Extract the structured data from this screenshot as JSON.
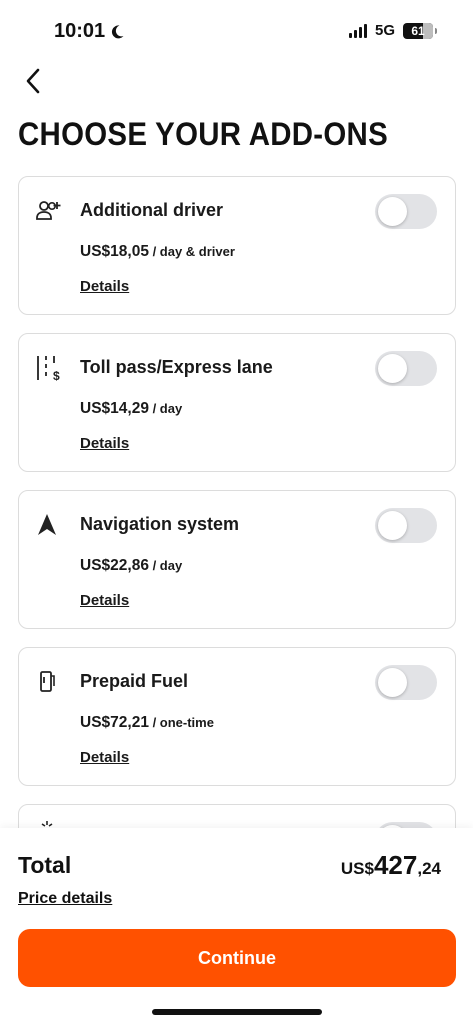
{
  "status": {
    "time": "10:01",
    "network": "5G",
    "battery": "61"
  },
  "header": {
    "title": "CHOOSE YOUR ADD-ONS"
  },
  "addons": [
    {
      "name": "Additional driver",
      "price": "US$18,05",
      "unit": " / day & driver",
      "details": "Details",
      "icon": "add-person-icon",
      "enabled": false
    },
    {
      "name": "Toll pass/Express lane",
      "price": "US$14,29",
      "unit": " / day",
      "details": "Details",
      "icon": "toll-road-icon",
      "enabled": false
    },
    {
      "name": "Navigation system",
      "price": "US$22,86",
      "unit": " / day",
      "details": "Details",
      "icon": "navigation-arrow-icon",
      "enabled": false
    },
    {
      "name": "Prepaid Fuel",
      "price": "US$72,21",
      "unit": " / one-time",
      "details": "Details",
      "icon": "fuel-pump-icon",
      "enabled": false
    }
  ],
  "footer": {
    "total_label": "Total",
    "total_currency": "US$",
    "total_whole": "427",
    "total_cents": ",24",
    "price_details": "Price details",
    "continue": "Continue"
  },
  "colors": {
    "accent": "#ff5100",
    "toggle_off": "#e2e3e6"
  }
}
